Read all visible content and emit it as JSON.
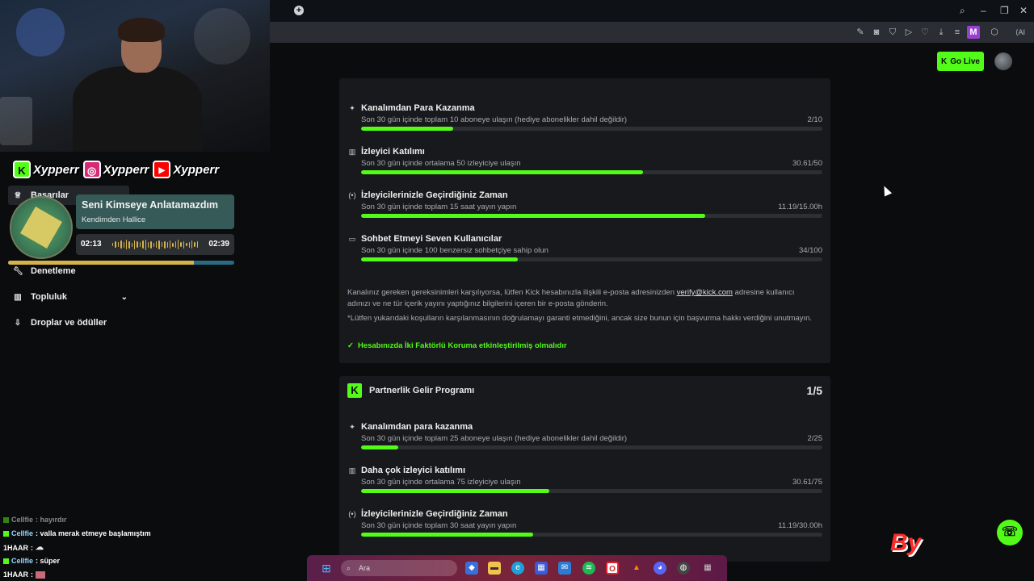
{
  "browser": {
    "new_tab_icon": "plus-circle-icon",
    "profile_letter": "M",
    "ai_label": "AI"
  },
  "header": {
    "go_live_label": "Go Live"
  },
  "affiliate": {
    "requirements": [
      {
        "icon": "sparkle-icon",
        "title": "Kanalımdan Para Kazanma",
        "desc": "Son 30 gün içinde toplam 10 aboneye ulaşın (hediye abonelikler dahil değildir)",
        "progress_text": "2/10",
        "fill": 0.2
      },
      {
        "icon": "viewers-icon",
        "title": "İzleyici Katılımı",
        "desc": "Son 30 gün içinde ortalama 50 izleyiciye ulaşın",
        "progress_text": "30.61/50",
        "fill": 0.612
      },
      {
        "icon": "broadcast-icon",
        "title": "İzleyicilerinizle Geçirdiğiniz Zaman",
        "desc": "Son 30 gün içinde toplam 15 saat yayın yapın",
        "progress_text": "11.19/15.00h",
        "fill": 0.746
      },
      {
        "icon": "chat-icon",
        "title": "Sohbet Etmeyi Seven Kullanıcılar",
        "desc": "Son 30 gün içinde 100 benzersiz sohbetçiye sahip olun",
        "progress_text": "34/100",
        "fill": 0.34
      }
    ],
    "note1_part1": "Kanalınız gereken gereksinimleri karşılıyorsa, lütfen Kick hesabınızla ilişkili e-posta adresinizden",
    "note1_link": "verify@kick.com",
    "note1_part2": "adresine kullanıcı adınızı ve ne tür içerik yayını yaptığınız bilgilerini içeren bir e-posta gönderin.",
    "note2": "*Lütfen yukarıdaki koşulların karşılanmasının doğrulamayı garanti etmediğini, ancak size bunun için başvurma hakkı verdiğini unutmayın.",
    "twofa": "Hesabınızda İki Faktörlü Koruma etkinleştirilmiş olmalıdır"
  },
  "partner": {
    "title": "Partnerlik Gelir Programı",
    "count": "1/5",
    "logo_letter": "K",
    "requirements": [
      {
        "icon": "sparkle-icon",
        "title": "Kanalımdan para kazanma",
        "desc": "Son 30 gün içinde toplam 25 aboneye ulaşın (hediye abonelikler dahil değildir)",
        "progress_text": "2/25",
        "fill": 0.08
      },
      {
        "icon": "viewers-icon",
        "title": "Daha çok izleyici katılımı",
        "desc": "Son 30 gün içinde ortalama 75 izleyiciye ulaşın",
        "progress_text": "30.61/75",
        "fill": 0.408
      },
      {
        "icon": "broadcast-icon",
        "title": "İzleyicilerinizle Geçirdiğiniz Zaman",
        "desc": "Son 30 gün içinde toplam 30 saat yayın yapın",
        "progress_text": "11.19/30.00h",
        "fill": 0.373
      }
    ]
  },
  "sidebar": {
    "items": [
      {
        "label": "Başarılar",
        "icon": "trophy-icon"
      },
      {
        "label": "Denetleme",
        "icon": "wrench-icon"
      },
      {
        "label": "Topluluk",
        "icon": "community-icon"
      },
      {
        "label": "Droplar ve ödüller",
        "icon": "drops-icon"
      }
    ]
  },
  "overlay": {
    "socials": [
      {
        "letter": "K",
        "name": "Xypperr",
        "color": "#53fc18"
      },
      {
        "letter": "◎",
        "name": "Xypperr",
        "color": "#d62976"
      },
      {
        "letter": "▶",
        "name": "Xypperr",
        "color": "#ff0000"
      }
    ],
    "song_title": "Seni Kimseye Anlatamazdım",
    "song_artist": "Kendimden Hallice",
    "time_current": "02:13",
    "time_total": "02:39",
    "song_progress": 0.82
  },
  "chat": [
    {
      "user": "Cellfie",
      "msg": ": hayırdır"
    },
    {
      "user": "Cellfie",
      "msg": ": valla merak etmeye başlamıştım"
    },
    {
      "user": "1HAAR",
      "msg": ":"
    },
    {
      "user": "Cellfie",
      "msg": ": süper"
    },
    {
      "user": "1HAAR",
      "msg": ":"
    }
  ],
  "taskbar": {
    "search_placeholder": "Ara"
  },
  "watermark": "By"
}
